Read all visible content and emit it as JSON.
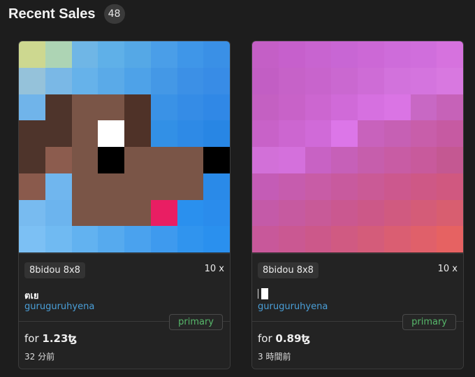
{
  "header": {
    "title": "Recent Sales",
    "count": "48"
  },
  "cards": [
    {
      "collection": "8bidou 8x8",
      "edition": "10 x",
      "token_name": "ตเย",
      "creator": "guruguruhyena",
      "badge": "primary",
      "price_prefix": "for ",
      "price_amount": "1.23ꜩ",
      "time": "32 分前",
      "pixels": [
        "#cdd890",
        "#add4b4",
        "#6fb6e6",
        "#5fb0e8",
        "#55a8e6",
        "#4a9ee8",
        "#3f96e8",
        "#3a90e6",
        "#95c2da",
        "#7ab8e6",
        "#66b2ea",
        "#5aaae8",
        "#4ea2e8",
        "#4498e6",
        "#3c90e6",
        "#388ce6",
        "#70b4ea",
        "#4e342b",
        "#7a5547",
        "#7a5547",
        "#4f3228",
        "#3a92e6",
        "#358ce6",
        "#3088e6",
        "#4e342b",
        "#4e342b",
        "#7a5547",
        "#ffffff",
        "#4f3228",
        "#3290e6",
        "#2e8ae6",
        "#2886e4",
        "#4e342b",
        "#8c5c4e",
        "#7a5547",
        "#000000",
        "#7a5547",
        "#7a5547",
        "#7a5547",
        "#000000",
        "#8a5a4c",
        "#70b6ee",
        "#7a5547",
        "#7a5547",
        "#7a5547",
        "#7a5547",
        "#7a5547",
        "#2a8ae8",
        "#78bbf0",
        "#6cb4ee",
        "#7a5547",
        "#7a5547",
        "#7a5547",
        "#e91e63",
        "#2a90ee",
        "#2a8cec",
        "#7cc0f4",
        "#70baf2",
        "#62b2f0",
        "#56aaee",
        "#4aa2ee",
        "#3e9aee",
        "#3094ee",
        "#2a90ee"
      ]
    },
    {
      "collection": "8bidou 8x8",
      "edition": "10 x",
      "token_name": "",
      "creator": "guruguruhyena",
      "badge": "primary",
      "price_prefix": "for ",
      "price_amount": "0.89ꜩ",
      "time": "3 時間前",
      "pixels": [
        "#c45fc6",
        "#c660cc",
        "#c864d0",
        "#c866d4",
        "#cc68d6",
        "#ce6cda",
        "#d06edc",
        "#d672de",
        "#c25ec4",
        "#c662c8",
        "#c864cc",
        "#ca68d0",
        "#ce6cd6",
        "#d272dc",
        "#d474de",
        "#d878e0",
        "#c460c2",
        "#c862c8",
        "#cc66d0",
        "#d06ad8",
        "#d670e0",
        "#da74e4",
        "#c868c4",
        "#c662b8",
        "#c862c8",
        "#cc66d0",
        "#d06ad8",
        "#dc76e8",
        "#c862bc",
        "#c660b4",
        "#c85eaa",
        "#c65aa2",
        "#d270d8",
        "#d470dc",
        "#c862c4",
        "#c660b8",
        "#c65eac",
        "#c85ca4",
        "#c85a9c",
        "#c45892",
        "#c45cb6",
        "#c65cae",
        "#c85ca6",
        "#c85a9e",
        "#ca5a96",
        "#cc588e",
        "#ce5886",
        "#d05880",
        "#c45aa8",
        "#c65aa0",
        "#c85a98",
        "#ca5890",
        "#cc5888",
        "#d05a80",
        "#d45c78",
        "#d85e70",
        "#c8589a",
        "#ca5892",
        "#cc588a",
        "#d05a82",
        "#d45c7a",
        "#da5e72",
        "#e0606a",
        "#e66262"
      ]
    }
  ]
}
